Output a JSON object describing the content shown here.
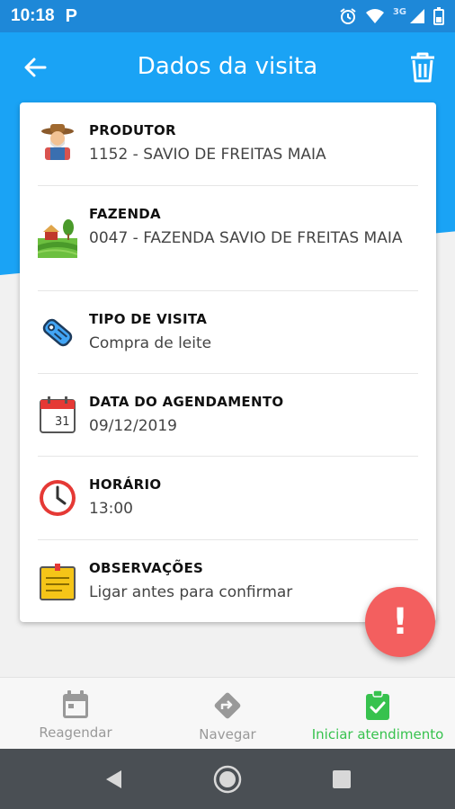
{
  "status_bar": {
    "time": "10:18",
    "app_letter": "P",
    "network": "3G"
  },
  "app_bar": {
    "title": "Dados da visita"
  },
  "colors": {
    "primary": "#1aa3f5",
    "status": "#1e88d8",
    "fab": "#f35f5f",
    "active": "#37c24e",
    "inactive": "#999999"
  },
  "card": {
    "rows": [
      {
        "label": "PRODUTOR",
        "value": "1152 - SAVIO DE FREITAS MAIA",
        "icon": "farmer-icon"
      },
      {
        "label": "FAZENDA",
        "value": "0047 - FAZENDA SAVIO DE FREITAS MAIA",
        "icon": "farm-icon"
      },
      {
        "label": "TIPO DE VISITA",
        "value": "Compra de leite",
        "icon": "tag-icon"
      },
      {
        "label": "DATA DO AGENDAMENTO",
        "value": "09/12/2019",
        "icon": "calendar-icon",
        "calendar_day": "31"
      },
      {
        "label": "HORÁRIO",
        "value": "13:00",
        "icon": "clock-icon"
      },
      {
        "label": "OBSERVAÇÕES",
        "value": "Ligar antes para confirmar",
        "icon": "note-icon"
      }
    ]
  },
  "fab": {
    "icon": "exclamation-icon",
    "symbol": "!"
  },
  "bottom_nav": {
    "items": [
      {
        "label": "Reagendar",
        "icon": "calendar-icon",
        "active": false
      },
      {
        "label": "Navegar",
        "icon": "directions-icon",
        "active": false
      },
      {
        "label": "Iniciar atendimento",
        "icon": "clipboard-check-icon",
        "active": true
      }
    ]
  }
}
